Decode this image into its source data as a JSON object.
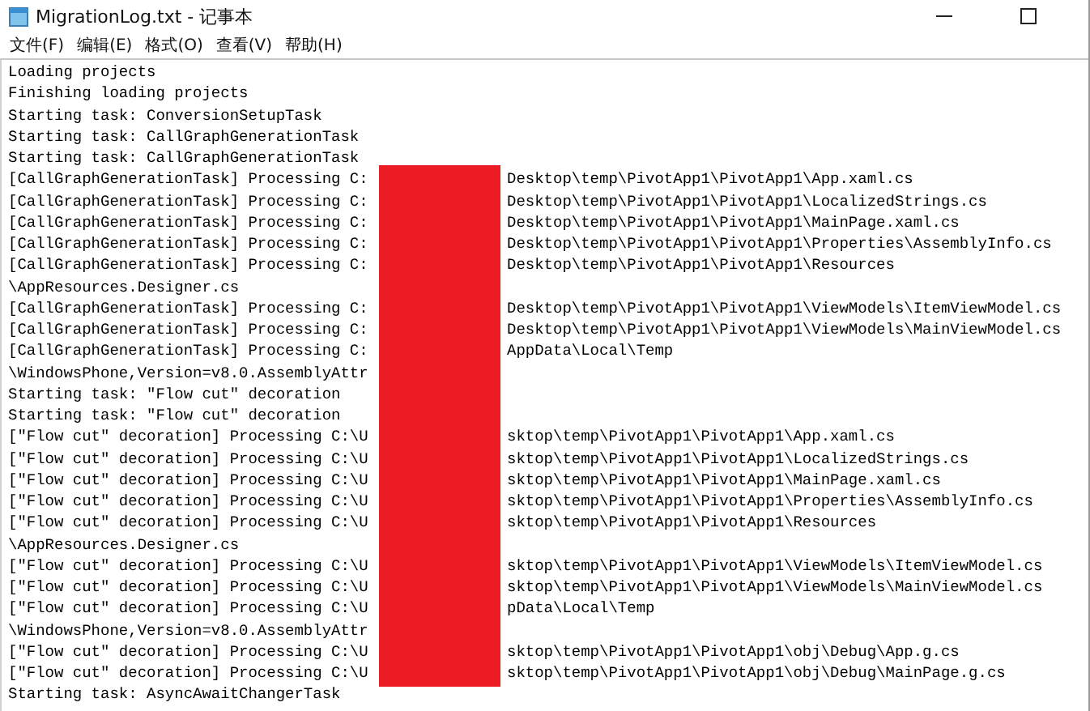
{
  "window": {
    "title": "MigrationLog.txt - 记事本"
  },
  "menu": [
    "文件(F)",
    "编辑(E)",
    "格式(O)",
    "查看(V)",
    "帮助(H)"
  ],
  "lines": [
    {
      "text": "Loading projects"
    },
    {
      "text": "Finishing loading projects"
    },
    {
      "text": "Starting task: ConversionSetupTask"
    },
    {
      "text": "Starting task: CallGraphGenerationTask"
    },
    {
      "text": "Starting task: CallGraphGenerationTask"
    },
    {
      "text": "[CallGraphGenerationTask] Processing C:",
      "rest": "Desktop\\temp\\PivotApp1\\PivotApp1\\App.xaml.cs"
    },
    {
      "text": "[CallGraphGenerationTask] Processing C:",
      "rest": "Desktop\\temp\\PivotApp1\\PivotApp1\\LocalizedStrings.cs"
    },
    {
      "text": "[CallGraphGenerationTask] Processing C:",
      "rest": "Desktop\\temp\\PivotApp1\\PivotApp1\\MainPage.xaml.cs"
    },
    {
      "text": "[CallGraphGenerationTask] Processing C:",
      "rest": "Desktop\\temp\\PivotApp1\\PivotApp1\\Properties\\AssemblyInfo.cs"
    },
    {
      "text": "[CallGraphGenerationTask] Processing C:",
      "rest": "Desktop\\temp\\PivotApp1\\PivotApp1\\Resources"
    },
    {
      "text": "\\AppResources.Designer.cs"
    },
    {
      "text": "[CallGraphGenerationTask] Processing C:",
      "rest": "Desktop\\temp\\PivotApp1\\PivotApp1\\ViewModels\\ItemViewModel.cs"
    },
    {
      "text": "[CallGraphGenerationTask] Processing C:",
      "rest": "Desktop\\temp\\PivotApp1\\PivotApp1\\ViewModels\\MainViewModel.cs"
    },
    {
      "text": "[CallGraphGenerationTask] Processing C:",
      "rest": "AppData\\Local\\Temp"
    },
    {
      "text": "\\WindowsPhone,Version=v8.0.AssemblyAttr"
    },
    {
      "text": "Starting task: \"Flow cut\" decoration"
    },
    {
      "text": "Starting task: \"Flow cut\" decoration"
    },
    {
      "text": "[\"Flow cut\" decoration] Processing C:\\U",
      "rest": "sktop\\temp\\PivotApp1\\PivotApp1\\App.xaml.cs"
    },
    {
      "text": "[\"Flow cut\" decoration] Processing C:\\U",
      "rest": "sktop\\temp\\PivotApp1\\PivotApp1\\LocalizedStrings.cs"
    },
    {
      "text": "[\"Flow cut\" decoration] Processing C:\\U",
      "rest": "sktop\\temp\\PivotApp1\\PivotApp1\\MainPage.xaml.cs"
    },
    {
      "text": "[\"Flow cut\" decoration] Processing C:\\U",
      "rest": "sktop\\temp\\PivotApp1\\PivotApp1\\Properties\\AssemblyInfo.cs"
    },
    {
      "text": "[\"Flow cut\" decoration] Processing C:\\U",
      "rest": "sktop\\temp\\PivotApp1\\PivotApp1\\Resources"
    },
    {
      "text": "\\AppResources.Designer.cs"
    },
    {
      "text": "[\"Flow cut\" decoration] Processing C:\\U",
      "rest": "sktop\\temp\\PivotApp1\\PivotApp1\\ViewModels\\ItemViewModel.cs"
    },
    {
      "text": "[\"Flow cut\" decoration] Processing C:\\U",
      "rest": "sktop\\temp\\PivotApp1\\PivotApp1\\ViewModels\\MainViewModel.cs"
    },
    {
      "text": "[\"Flow cut\" decoration] Processing C:\\U",
      "rest": "pData\\Local\\Temp"
    },
    {
      "text": "\\WindowsPhone,Version=v8.0.AssemblyAttr"
    },
    {
      "text": "[\"Flow cut\" decoration] Processing C:\\U",
      "rest": "sktop\\temp\\PivotApp1\\PivotApp1\\obj\\Debug\\App.g.cs"
    },
    {
      "text": "[\"Flow cut\" decoration] Processing C:\\U",
      "rest": "sktop\\temp\\PivotApp1\\PivotApp1\\obj\\Debug\\MainPage.g.cs"
    },
    {
      "text": "Starting task: AsyncAwaitChangerTask"
    }
  ]
}
